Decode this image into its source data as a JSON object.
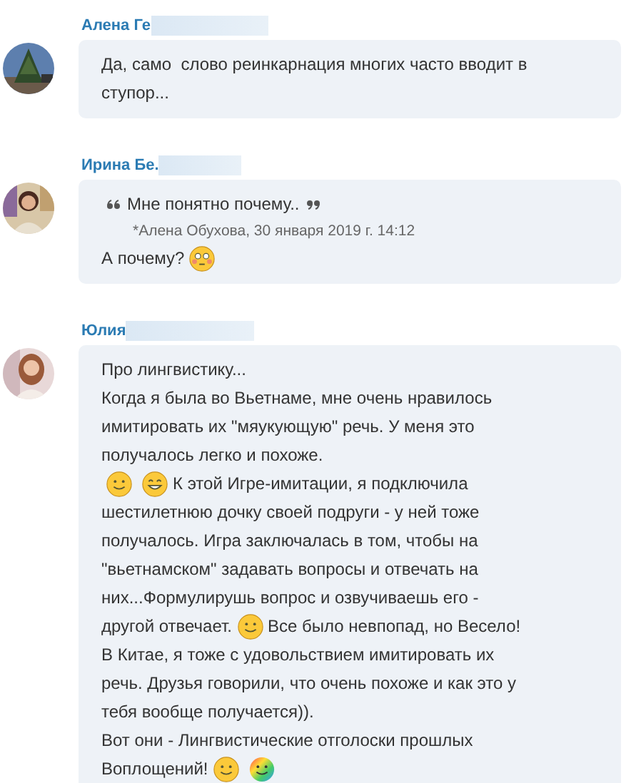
{
  "messages": [
    {
      "author": "Алена Ге",
      "lines": [
        [
          {
            "kind": "text",
            "text": "Да, само  слово реинкарнация многих часто вводит в"
          }
        ],
        [
          {
            "kind": "text",
            "text": "ступор..."
          }
        ]
      ]
    },
    {
      "author": "Ирина Бе.",
      "quote": {
        "text": "Мне понятно почему..",
        "source": "*Алена Обухова, 30 января 2019 г. 14:12"
      },
      "lines": [
        [
          {
            "kind": "text",
            "text": "А почему?"
          },
          {
            "kind": "blush"
          }
        ]
      ]
    },
    {
      "author": "Юлия",
      "lines": [
        [
          {
            "kind": "text",
            "text": "Про лингвистику..."
          }
        ],
        [
          {
            "kind": "text",
            "text": "Когда я была во Вьетнаме, мне очень нравилось"
          }
        ],
        [
          {
            "kind": "text",
            "text": "имитировать их \"мяукующую\" речь. У меня это"
          }
        ],
        [
          {
            "kind": "text",
            "text": "получалось легко и похоже."
          }
        ],
        [
          {
            "kind": "smile"
          },
          {
            "kind": "grin"
          },
          {
            "kind": "text",
            "text": "К этой Игре-имитации, я подключила"
          }
        ],
        [
          {
            "kind": "text",
            "text": "шестилетнюю дочку своей подруги - у ней тоже"
          }
        ],
        [
          {
            "kind": "text",
            "text": "получалось. Игра заключалась в том, чтобы на"
          }
        ],
        [
          {
            "kind": "text",
            "text": "\"вьетнамском\" задавать вопросы и отвечать на"
          }
        ],
        [
          {
            "kind": "text",
            "text": "них...Формулирушь вопрос и озвучиваешь его -"
          }
        ],
        [
          {
            "kind": "text",
            "text": "другой отвечает."
          },
          {
            "kind": "smile"
          },
          {
            "kind": "text",
            "text": "Все было невпопад, но Весело!"
          }
        ],
        [
          {
            "kind": "text",
            "text": "В Китае, я тоже с удовольствием имитировать их"
          }
        ],
        [
          {
            "kind": "text",
            "text": "речь. Друзья говорили, что очень похоже и как это у"
          }
        ],
        [
          {
            "kind": "text",
            "text": "тебя вообще получается))."
          }
        ],
        [
          {
            "kind": "text",
            "text": "Вот они - Лингвистические отголоски прошлых"
          }
        ],
        [
          {
            "kind": "text",
            "text": "Воплощений!"
          },
          {
            "kind": "smile"
          },
          {
            "kind": "rainbow"
          }
        ]
      ]
    }
  ]
}
